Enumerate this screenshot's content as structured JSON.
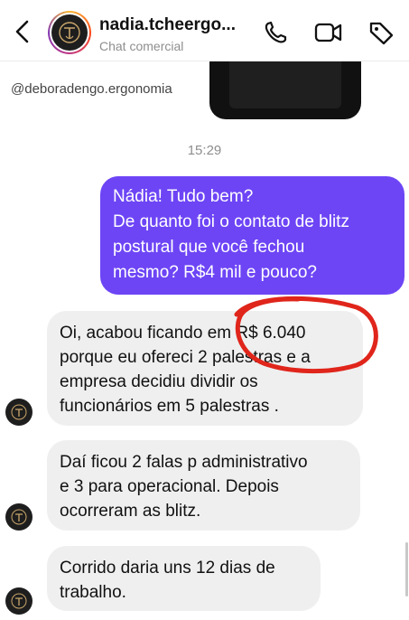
{
  "header": {
    "username": "nadia.tcheergo...",
    "subtitle": "Chat comercial",
    "icons": [
      "back-chevron-icon",
      "phone-icon",
      "video-icon",
      "tag-icon"
    ],
    "avatar_initial": "T"
  },
  "chat": {
    "shared_post_handle": "@deboradengo.ergonomia",
    "timestamp": "15:29",
    "outgoing": {
      "lines": [
        "Nádia! Tudo bem?",
        "De quanto foi o contato de blitz",
        "postural que você fechou",
        "mesmo? R$4 mil e pouco?"
      ]
    },
    "incoming": [
      {
        "lines": [
          "Oi, acabou ficando em R$ 6.040",
          "porque eu ofereci 2 palestras e a",
          "empresa decidiu dividir os",
          "funcionários em 5 palestras ."
        ]
      },
      {
        "lines": [
          "Daí ficou 2 falas p administrativo",
          "e 3 para operacional. Depois",
          "ocorreram as blitz."
        ]
      },
      {
        "lines": [
          "Corrido daria uns 12 dias de",
          "trabalho."
        ]
      }
    ]
  },
  "colors": {
    "outgoing_bubble": "#6d45f5",
    "incoming_bubble": "#efefef",
    "annotation_circle": "#e0251b",
    "avatar_bg": "#1e1e1e",
    "avatar_mark": "#c9a66b"
  }
}
